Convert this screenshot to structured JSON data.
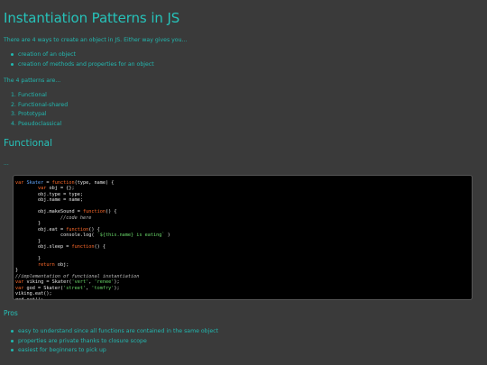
{
  "page": {
    "title": "Instantiation Patterns in JS",
    "intro": "There are 4 ways to create an object in JS. Either way gives you...",
    "intro_list": [
      "creation of an object",
      "creation of methods and properties for an object"
    ],
    "patterns_intro": "The 4 patterns are...",
    "patterns": [
      {
        "num": "1.",
        "label": "Functional"
      },
      {
        "num": "2.",
        "label": "Functional-shared"
      },
      {
        "num": "3.",
        "label": "Prototypal"
      },
      {
        "num": "4.",
        "label": "Pseudoclassical"
      }
    ],
    "section_heading": "Functional",
    "ellipsis": "...",
    "code_lines": [
      [
        {
          "t": "var ",
          "c": "kw"
        },
        {
          "t": "Skater",
          "c": "var"
        },
        {
          "t": " = ",
          "c": ""
        },
        {
          "t": "function",
          "c": "kw"
        },
        {
          "t": "(type, name) {",
          "c": ""
        }
      ],
      [
        {
          "t": "        ",
          "c": ""
        },
        {
          "t": "var",
          "c": "kw"
        },
        {
          "t": " obj = {};",
          "c": ""
        }
      ],
      [
        {
          "t": "        obj.type = type;",
          "c": ""
        }
      ],
      [
        {
          "t": "        obj.name = name;",
          "c": ""
        }
      ],
      [
        {
          "t": "",
          "c": ""
        }
      ],
      [
        {
          "t": "        obj.makeSound = ",
          "c": ""
        },
        {
          "t": "function",
          "c": "kw"
        },
        {
          "t": "() {",
          "c": ""
        }
      ],
      [
        {
          "t": "                ",
          "c": ""
        },
        {
          "t": "//code here",
          "c": "cm"
        }
      ],
      [
        {
          "t": "        }",
          "c": ""
        }
      ],
      [
        {
          "t": "        obj.eat = ",
          "c": ""
        },
        {
          "t": "function",
          "c": "kw"
        },
        {
          "t": "() {",
          "c": ""
        }
      ],
      [
        {
          "t": "                console.log( ",
          "c": ""
        },
        {
          "t": "`${this.name} is eating`",
          "c": "tpl"
        },
        {
          "t": " )",
          "c": ""
        }
      ],
      [
        {
          "t": "        }",
          "c": ""
        }
      ],
      [
        {
          "t": "        obj.sleep = ",
          "c": ""
        },
        {
          "t": "function",
          "c": "kw"
        },
        {
          "t": "() {",
          "c": ""
        }
      ],
      [
        {
          "t": "",
          "c": ""
        }
      ],
      [
        {
          "t": "        }",
          "c": ""
        }
      ],
      [
        {
          "t": "        ",
          "c": ""
        },
        {
          "t": "return",
          "c": "kw"
        },
        {
          "t": " obj;",
          "c": ""
        }
      ],
      [
        {
          "t": "}",
          "c": ""
        }
      ],
      [
        {
          "t": "//implementation of functional instantiation",
          "c": "cm"
        }
      ],
      [
        {
          "t": "var",
          "c": "kw"
        },
        {
          "t": " viking = Skater(",
          "c": ""
        },
        {
          "t": "'vert'",
          "c": "str"
        },
        {
          "t": ", ",
          "c": ""
        },
        {
          "t": "'renee'",
          "c": "str"
        },
        {
          "t": ");",
          "c": ""
        }
      ],
      [
        {
          "t": "var",
          "c": "kw"
        },
        {
          "t": " god = Skater(",
          "c": ""
        },
        {
          "t": "'street'",
          "c": "str"
        },
        {
          "t": ", ",
          "c": ""
        },
        {
          "t": "'tomfry'",
          "c": "str"
        },
        {
          "t": ");",
          "c": ""
        }
      ],
      [
        {
          "t": "viking.eat();",
          "c": ""
        }
      ],
      [
        {
          "t": "god.eat();",
          "c": ""
        }
      ]
    ],
    "pros_heading": "Pros",
    "pros": [
      "easy to understand since all functions are contained in the same object",
      "properties are private thanks to closure scope",
      "easiest for beginners to pick up"
    ]
  }
}
